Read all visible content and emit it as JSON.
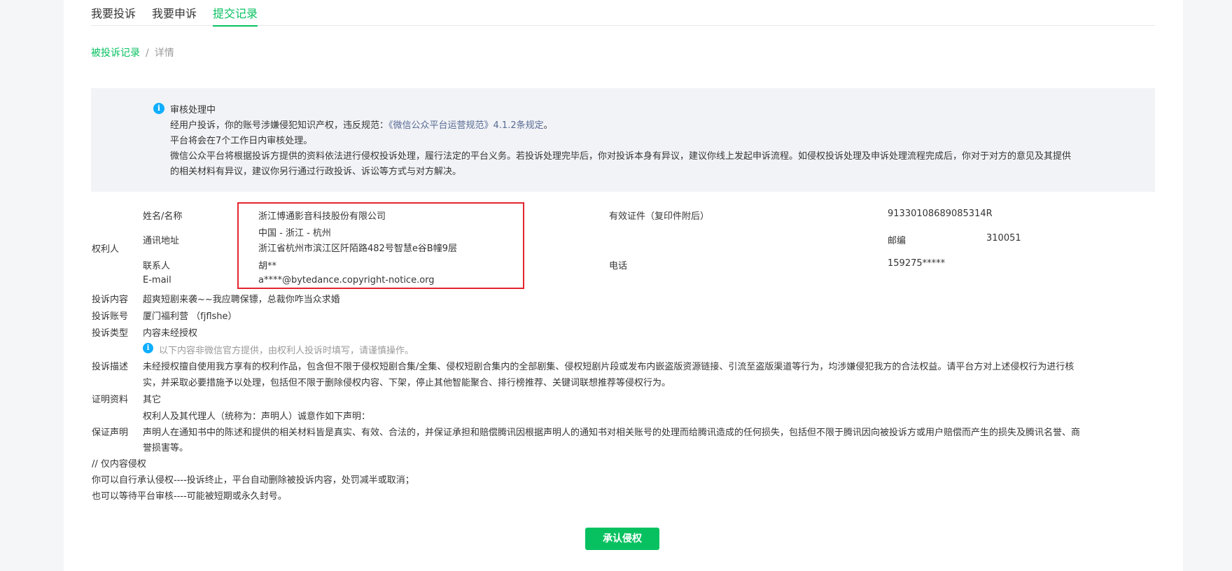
{
  "tabs": [
    {
      "label": "我要投诉"
    },
    {
      "label": "我要申诉"
    },
    {
      "label": "提交记录",
      "active": true
    }
  ],
  "breadcrumb": {
    "link": "被投诉记录",
    "separator": "/",
    "current": "详情"
  },
  "notice": {
    "icon": "info-icon",
    "title": "审核处理中",
    "line1_prefix": "经用户投诉，你的账号涉嫌侵犯知识产权，违反规范：",
    "line1_link": "《微信公众平台运营规范》4.1.2条规定",
    "line1_suffix": "。",
    "line2": "平台将会在7个工作日内审核处理。",
    "line3": "微信公众平台将根据投诉方提供的资料依法进行侵权投诉处理，履行法定的平台义务。若投诉处理完毕后，你对投诉本身有异议，建议你线上发起申诉流程。如侵权投诉处理及申诉处理流程完成后，你对于对方的意见及其提供",
    "line4": "的相关材料有异议，建议你另行通过行政投诉、诉讼等方式与对方解决。"
  },
  "rights_holder": {
    "section_label": "权利人",
    "name_label": "姓名/名称",
    "name_value": "浙江博通影音科技股份有限公司",
    "id_label": "有效证件（复印件附后）",
    "id_value": "91330108689085314R",
    "address_label": "通讯地址",
    "address_line1": "中国 - 浙江 - 杭州",
    "address_line2": "浙江省杭州市滨江区阡陌路482号智慧e谷B幢9层",
    "postcode_label": "邮编",
    "postcode_value": "310051",
    "contact_label": "联系人",
    "contact_value": "胡**",
    "phone_label": "电话",
    "phone_value": "159275*****",
    "email_label": "E-mail",
    "email_value": "a****@bytedance.copyright-notice.org"
  },
  "complaint": {
    "content_label": "投诉内容",
    "content_value": "超爽短剧来袭~~我应聘保镖，总裁你咋当众求婚",
    "account_label": "投诉账号",
    "account_value": "厦门福利营 （fjflshe）",
    "type_label": "投诉类型",
    "type_value": "内容未经授权",
    "hint": "以下内容非微信官方提供，由权利人投诉时填写，请谨慎操作。",
    "desc_label": "投诉描述",
    "desc_line1": "未经授权擅自使用我方享有的权利作品，包含但不限于侵权短剧合集/全集、侵权短剧合集内的全部剧集、侵权短剧片段或发布内嵌盗版资源链接、引流至盗版渠道等行为，均涉嫌侵犯我方的合法权益。请平台方对上述侵权行为进行核",
    "desc_line2": "实，并采取必要措施予以处理，包括但不限于删除侵权内容、下架，停止其他智能聚合、排行榜推荐、关键词联想推荐等侵权行为。",
    "proof_label": "证明资料",
    "proof_value": "其它",
    "statement_label": "保证声明",
    "statement_line1": "权利人及其代理人（统称为：声明人）诚意作如下声明：",
    "statement_line2": "声明人在通知书中的陈述和提供的相关材料皆是真实、有效、合法的，并保证承担和赔偿腾讯因根据声明人的通知书对相关账号的处理而给腾讯造成的任何损失，包括但不限于腾讯因向被投诉方或用户赔偿而产生的损失及腾讯名誉、商",
    "statement_line3": "誉损害等。"
  },
  "notes": {
    "line1": "// 仅内容侵权",
    "line2": "你可以自行承认侵权----投诉终止，平台自动删除被投诉内容，处罚减半或取消；",
    "line3": "也可以等待平台审核----可能被短期或永久封号。"
  },
  "action": {
    "button_label": "承认侵权"
  },
  "colors": {
    "accent": "#07c160",
    "link": "#576b95",
    "info": "#10aeff",
    "highlight_box": "#e3262e"
  }
}
